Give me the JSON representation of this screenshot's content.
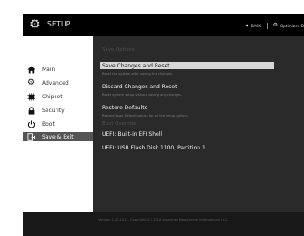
{
  "header": {
    "title": "SETUP",
    "back_label": "BACK",
    "optimized_label": "Optimized D"
  },
  "sidebar": {
    "items": [
      {
        "label": "Main",
        "icon": "home-icon"
      },
      {
        "label": "Advanced",
        "icon": "gear-icon"
      },
      {
        "label": "Chipset",
        "icon": "chip-icon"
      },
      {
        "label": "Security",
        "icon": "lock-icon"
      },
      {
        "label": "Boot",
        "icon": "power-icon"
      },
      {
        "label": "Save & Exit",
        "icon": "exit-icon"
      }
    ],
    "active_index": 5
  },
  "main": {
    "save_options_heading": "Save Options",
    "options": [
      {
        "label": "Save Changes and Reset",
        "desc": "Reset the system after saving the changes."
      },
      {
        "label": "Discard Changes and Reset",
        "desc": "Reset system setup without saving any changes."
      },
      {
        "label": "Restore Defaults",
        "desc": "Restore/Load Default values for all the setup options."
      }
    ],
    "boot_override_heading": "Boot Override",
    "boot_override": [
      "UEFI: Built-in EFI Shell",
      "UEFI: USB Flash Disk 1100, Partition 1"
    ]
  },
  "footer": {
    "text": "Version 2.20.1011. Copyright (C) 2018 American Megatrends International LLC."
  },
  "colors": {
    "active_sidebar": "#555555",
    "highlight": "#d6d6d6",
    "background": "#2a2a2a"
  }
}
